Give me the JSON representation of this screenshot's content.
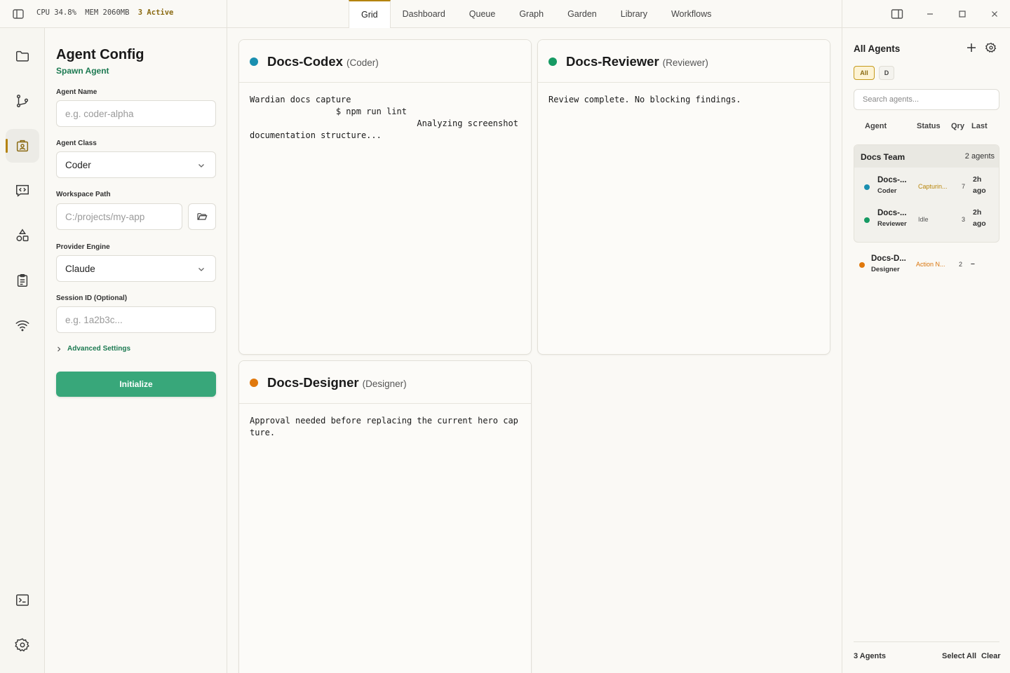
{
  "topbar": {
    "cpu": "CPU 34.8%",
    "mem": "MEM 2060MB",
    "active": "3 Active",
    "tabs": [
      "Grid",
      "Dashboard",
      "Queue",
      "Graph",
      "Garden",
      "Library",
      "Workflows"
    ],
    "active_tab": "Grid"
  },
  "rail": {
    "items": [
      "folder-icon",
      "git-branch-icon",
      "agent-config-icon",
      "code-chat-icon",
      "shapes-icon",
      "clipboard-icon",
      "wifi-icon"
    ],
    "bottom": [
      "terminal-icon",
      "settings-icon"
    ]
  },
  "config": {
    "title": "Agent Config",
    "subtitle": "Spawn Agent",
    "agent_name_label": "Agent Name",
    "agent_name_placeholder": "e.g. coder-alpha",
    "agent_class_label": "Agent Class",
    "agent_class_value": "Coder",
    "workspace_label": "Workspace Path",
    "workspace_placeholder": "C:/projects/my-app",
    "provider_label": "Provider Engine",
    "provider_value": "Claude",
    "session_label": "Session ID (Optional)",
    "session_placeholder": "e.g. 1a2b3c...",
    "advanced_label": "Advanced Settings",
    "init_label": "Initialize"
  },
  "cards": [
    {
      "name": "Docs-Codex",
      "role": "(Coder)",
      "color": "#1a8fb0",
      "output": "Wardian docs capture\n                 $ npm run lint\n                                 Analyzing screenshot documentation structure..."
    },
    {
      "name": "Docs-Reviewer",
      "role": "(Reviewer)",
      "color": "#169a63",
      "output": "Review complete. No blocking findings."
    },
    {
      "name": "Docs-Designer",
      "role": "(Designer)",
      "color": "#e0780c",
      "output": "Approval needed before replacing the current hero capture."
    }
  ],
  "agents_panel": {
    "title": "All Agents",
    "filters": [
      "All",
      "D"
    ],
    "search_placeholder": "Search agents...",
    "columns": [
      "Agent",
      "Status",
      "Qry",
      "Last"
    ],
    "group": {
      "name": "Docs Team",
      "count": "2 agents"
    },
    "group_rows": [
      {
        "name": "Docs-...",
        "role": "Coder",
        "status": "Capturin...",
        "status_color": "#b8860b",
        "qry": "7",
        "last": "2h ago",
        "color": "#1a8fb0"
      },
      {
        "name": "Docs-...",
        "role": "Reviewer",
        "status": "Idle",
        "status_color": "#555555",
        "qry": "3",
        "last": "2h ago",
        "color": "#169a63"
      }
    ],
    "ungrouped": {
      "name": "Docs-D...",
      "role": "Designer",
      "status": "Action N...",
      "status_color": "#d9740b",
      "qry": "2",
      "last": "–",
      "color": "#e0780c"
    },
    "footer_count": "3 Agents",
    "select_all": "Select All",
    "clear": "Clear"
  }
}
